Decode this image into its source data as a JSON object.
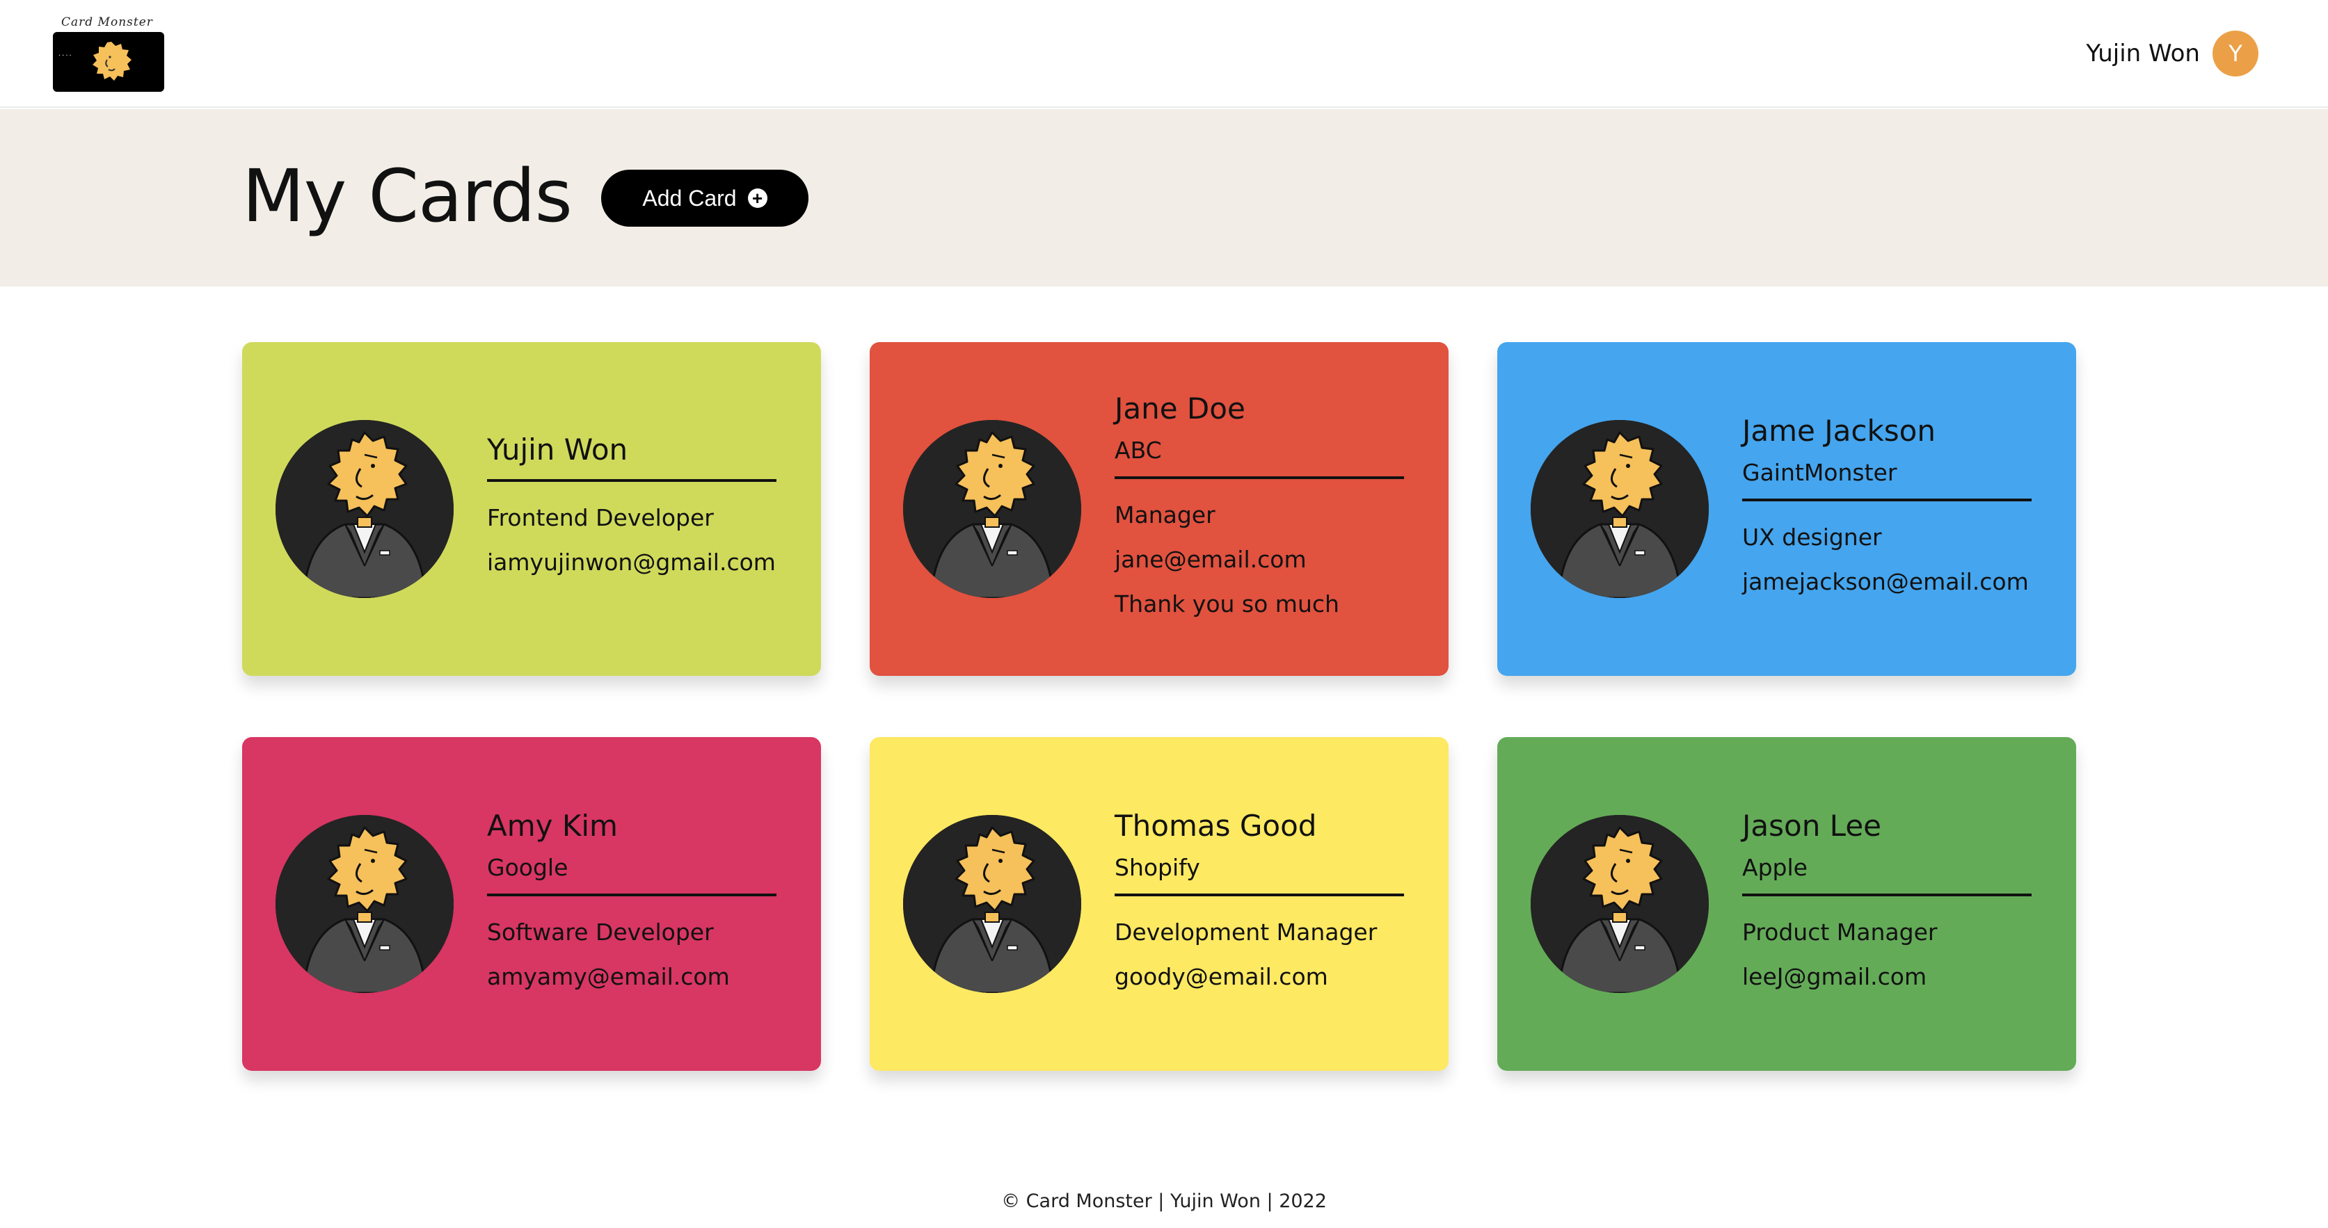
{
  "header": {
    "logo_text": "Card Monster",
    "user_name": "Yujin Won",
    "user_initial": "Y",
    "avatar_color": "#eba048"
  },
  "page": {
    "title": "My Cards",
    "add_button_label": "Add Card",
    "add_icon": "plus-circle-icon"
  },
  "cards": [
    {
      "name": "Yujin Won",
      "company": "",
      "lines": [
        "Frontend Developer",
        "iamyujinwon@gmail.com"
      ],
      "color": "#cfda5b"
    },
    {
      "name": "Jane Doe",
      "company": "ABC",
      "lines": [
        "Manager",
        "jane@email.com",
        "Thank you so much"
      ],
      "color": "#e1523f"
    },
    {
      "name": "Jame Jackson",
      "company": "GaintMonster",
      "lines": [
        "UX designer",
        "jamejackson@email.com"
      ],
      "color": "#45a5ee"
    },
    {
      "name": "Amy Kim",
      "company": "Google",
      "lines": [
        "Software Developer",
        "amyamy@email.com"
      ],
      "color": "#d83663"
    },
    {
      "name": "Thomas Good",
      "company": "Shopify",
      "lines": [
        "Development Manager",
        "goody@email.com"
      ],
      "color": "#fde962"
    },
    {
      "name": "Jason Lee",
      "company": "Apple",
      "lines": [
        "Product Manager",
        "leeJ@gmail.com"
      ],
      "color": "#64ab58"
    }
  ],
  "footer": {
    "text": "© Card Monster | Yujin Won | 2022"
  }
}
